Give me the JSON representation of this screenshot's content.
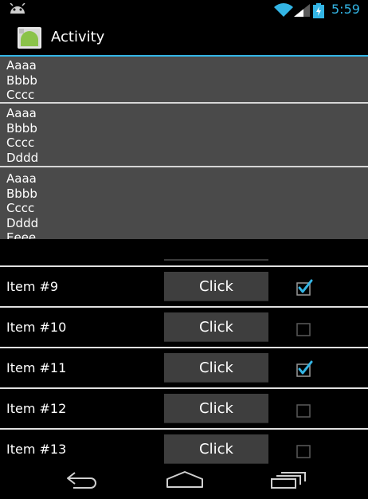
{
  "status_bar": {
    "time": "5:59",
    "icons": [
      "android-notification-icon",
      "wifi-icon",
      "cell-signal-icon",
      "battery-charging-icon"
    ],
    "clock_color": "#33b5e5"
  },
  "action_bar": {
    "title": "Activity",
    "app_icon": "app-launcher-icon",
    "accent_color": "#33b5e5"
  },
  "text_blocks": [
    {
      "lines": [
        "Aaaa",
        "Bbbb",
        "Cccc"
      ]
    },
    {
      "lines": [
        "Aaaa",
        "Bbbb",
        "Cccc",
        "Dddd"
      ]
    },
    {
      "lines": [
        "Aaaa",
        "Bbbb",
        "Cccc",
        "Dddd",
        "Eeee"
      ]
    }
  ],
  "list": {
    "items": [
      {
        "label": "Item #9",
        "button_label": "Click",
        "checked": true
      },
      {
        "label": "Item #10",
        "button_label": "Click",
        "checked": false
      },
      {
        "label": "Item #11",
        "button_label": "Click",
        "checked": true
      },
      {
        "label": "Item #12",
        "button_label": "Click",
        "checked": false
      },
      {
        "label": "Item #13",
        "button_label": "Click",
        "checked": false
      }
    ]
  },
  "nav_bar": {
    "buttons": [
      "back-icon",
      "home-icon",
      "recent-apps-icon"
    ]
  }
}
